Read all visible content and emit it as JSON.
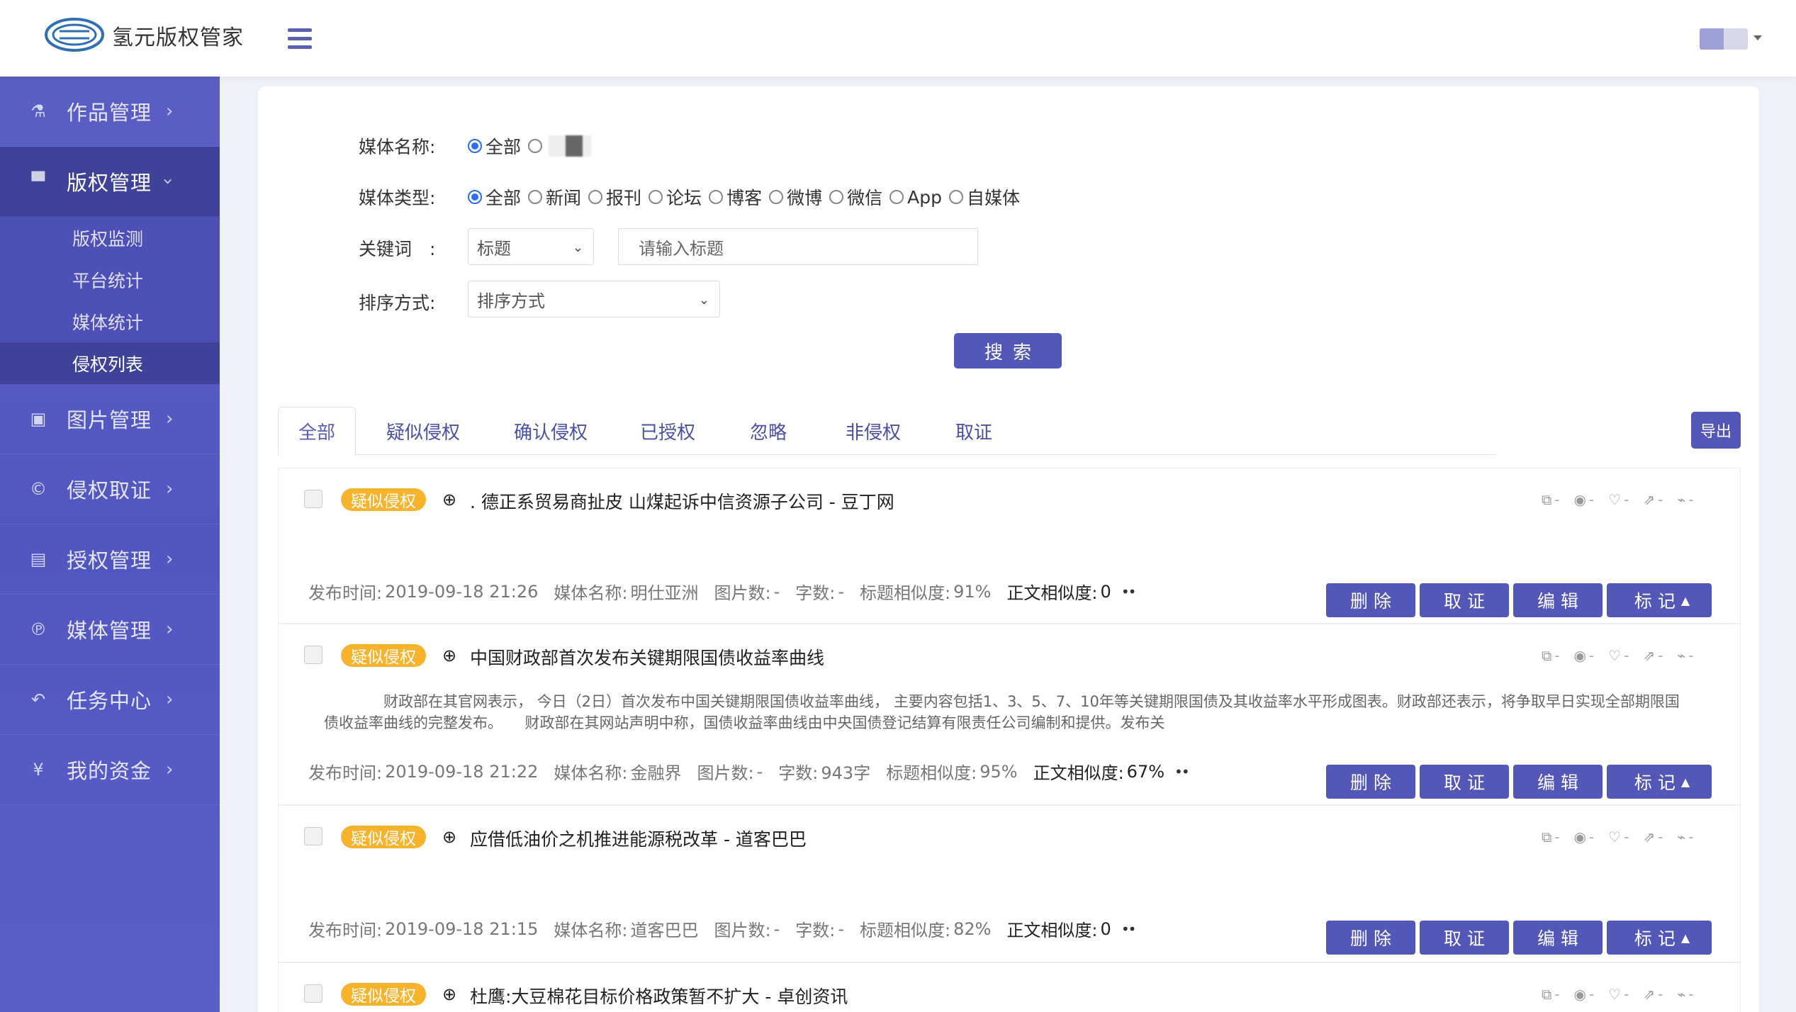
{
  "header": {
    "brand": "氢元版权管家"
  },
  "sidebar": {
    "items": [
      {
        "label": "作品管理",
        "icon": "⚗"
      },
      {
        "label": "版权管理",
        "icon": "▀"
      },
      {
        "label": "图片管理",
        "icon": "▣"
      },
      {
        "label": "侵权取证",
        "icon": "©"
      },
      {
        "label": "授权管理",
        "icon": "▤"
      },
      {
        "label": "媒体管理",
        "icon": "℗"
      },
      {
        "label": "任务中心",
        "icon": "↶"
      },
      {
        "label": "我的资金",
        "icon": "¥"
      }
    ],
    "subitems": [
      "版权监测",
      "平台统计",
      "媒体统计",
      "侵权列表"
    ]
  },
  "filters": {
    "media_name_label": "媒体名称:",
    "media_name_all": "全部",
    "media_type_label": "媒体类型:",
    "media_types": [
      "全部",
      "新闻",
      "报刊",
      "论坛",
      "博客",
      "微博",
      "微信",
      "App",
      "自媒体"
    ],
    "keyword_label": "关键词　:",
    "keyword_field": "标题",
    "keyword_placeholder": "请输入标题",
    "sort_label": "排序方式:",
    "sort_value": "排序方式",
    "search_button": "搜索"
  },
  "tabs": [
    "全部",
    "疑似侵权",
    "确认侵权",
    "已授权",
    "忽略",
    "非侵权",
    "取证"
  ],
  "export_button": "导出",
  "meta_labels": {
    "publish_time": "发布时间:",
    "media_name": "媒体名称:",
    "image_count": "图片数:",
    "word_count": "字数:",
    "title_similarity": "标题相似度:",
    "body_similarity": "正文相似度:"
  },
  "actions": {
    "delete": "删除",
    "evidence": "取证",
    "edit": "编辑",
    "mark": "标记"
  },
  "stat_value": "-",
  "records": [
    {
      "badge": "疑似侵权",
      "title": ". 德正系贸易商扯皮 山煤起诉中信资源子公司 - 豆丁网",
      "body": "",
      "publish_time": "2019-09-18 21:26",
      "media_name": "明仕亚洲",
      "image_count": "-",
      "word_count": "-",
      "title_similarity": "91%",
      "body_similarity": "0",
      "dots": "••"
    },
    {
      "badge": "疑似侵权",
      "title": "中国财政部首次发布关键期限国债收益率曲线",
      "body": "财政部在其官网表示， 今日（2日）首次发布中国关键期限国债收益率曲线， 主要内容包括1、3、5、7、10年等关键期限国债及其收益率水平形成图表。财政部还表示，将争取早日实现全部期限国债收益率曲线的完整发布。　　财政部在其网站声明中称，国债收益率曲线由中央国债登记结算有限责任公司编制和提供。发布关",
      "publish_time": "2019-09-18 21:22",
      "media_name": "金融界",
      "image_count": "-",
      "word_count": "943字",
      "title_similarity": "95%",
      "body_similarity": "67%",
      "dots": "••"
    },
    {
      "badge": "疑似侵权",
      "title": "应借低油价之机推进能源税改革 - 道客巴巴",
      "body": "",
      "publish_time": "2019-09-18 21:15",
      "media_name": "道客巴巴",
      "image_count": "-",
      "word_count": "-",
      "title_similarity": "82%",
      "body_similarity": "0",
      "dots": "••"
    },
    {
      "badge": "疑似侵权",
      "title": "杜鹰:大豆棉花目标价格政策暂不扩大 - 卓创资讯",
      "body": "",
      "publish_time": "",
      "media_name": "",
      "image_count": "",
      "word_count": "",
      "title_similarity": "",
      "body_similarity": "",
      "dots": ""
    }
  ]
}
